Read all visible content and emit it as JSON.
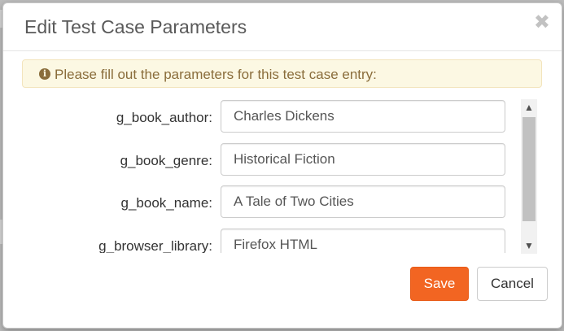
{
  "dialog": {
    "title": "Edit Test Case Parameters",
    "close_icon": "close-icon",
    "alert": {
      "icon": "info-circle-icon",
      "text": "Please fill out the parameters for this test case entry:"
    },
    "fields": [
      {
        "label": "g_book_author:",
        "value": "Charles Dickens"
      },
      {
        "label": "g_book_genre:",
        "value": "Historical Fiction"
      },
      {
        "label": "g_book_name:",
        "value": "A Tale of Two Cities"
      },
      {
        "label": "g_browser_library:",
        "value": "Firefox HTML"
      }
    ],
    "buttons": {
      "save_label": "Save",
      "cancel_label": "Cancel"
    }
  },
  "colors": {
    "accent": "#f26522",
    "alert_bg": "#fcf8e3",
    "alert_text": "#8a6d3b"
  }
}
